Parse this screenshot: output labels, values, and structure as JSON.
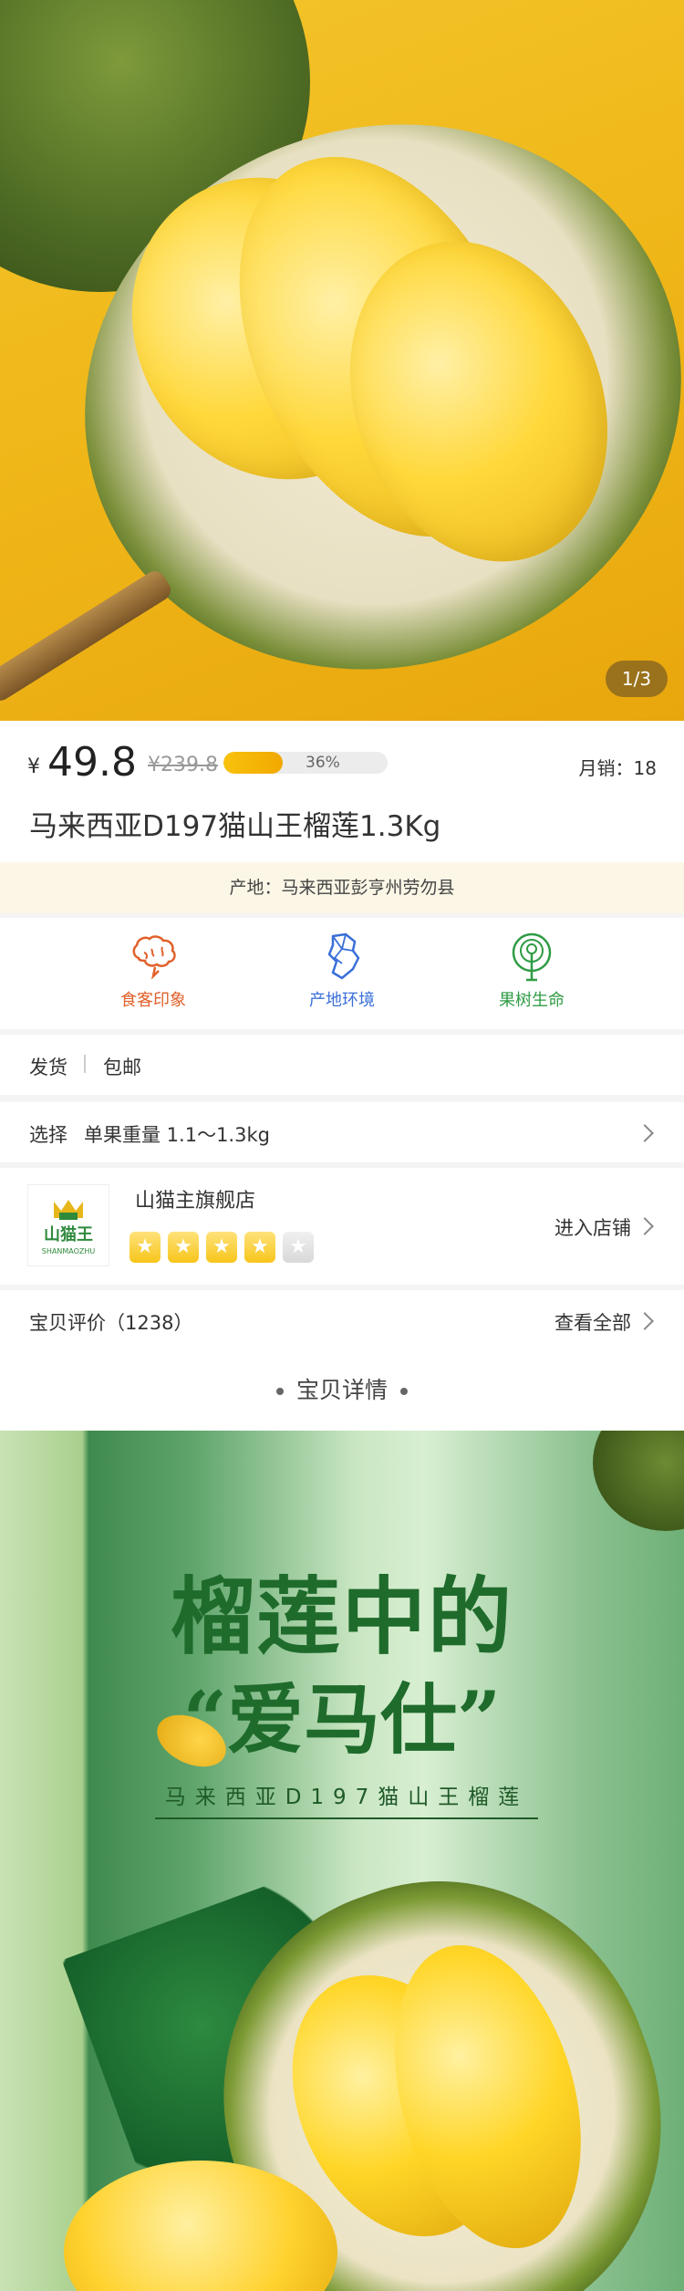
{
  "hero": {
    "pager": "1/3"
  },
  "price": {
    "currency": "¥",
    "current": "49.8",
    "original": "¥239.8",
    "progress_percent": 36,
    "progress_label": "36%",
    "monthly_sales": "月销：18"
  },
  "product": {
    "title": "马来西亚D197猫山王榴莲1.3Kg"
  },
  "origin": {
    "text": "产地：马来西亚彭亨州劳勿县"
  },
  "features": [
    {
      "label": "食客印象",
      "icon": "brain-icon",
      "color": "#e0612b"
    },
    {
      "label": "产地环境",
      "icon": "map-icon",
      "color": "#3a6fd8"
    },
    {
      "label": "果树生命",
      "icon": "tree-icon",
      "color": "#2f9c45"
    }
  ],
  "shipping": {
    "label": "发货",
    "value": "包邮"
  },
  "select": {
    "label": "选择",
    "value": "单果重量 1.1～1.3kg"
  },
  "store": {
    "name": "山猫主旗舰店",
    "logo_text": "山猫王",
    "logo_sub": "SHANMAOZHU",
    "rating": 4,
    "rating_max": 5,
    "enter_label": "进入店铺"
  },
  "reviews": {
    "label": "宝贝评价（1238）",
    "view_all": "查看全部"
  },
  "details": {
    "header": "宝贝详情"
  },
  "banner": {
    "headline": "榴莲中的",
    "headline2": "“爱马仕”",
    "subtitle": "马来西亚D197猫山王榴莲"
  },
  "colors": {
    "accent_yellow": "#f2b811",
    "green": "#1f6b2c",
    "origin_bg": "#fbf6e6"
  }
}
